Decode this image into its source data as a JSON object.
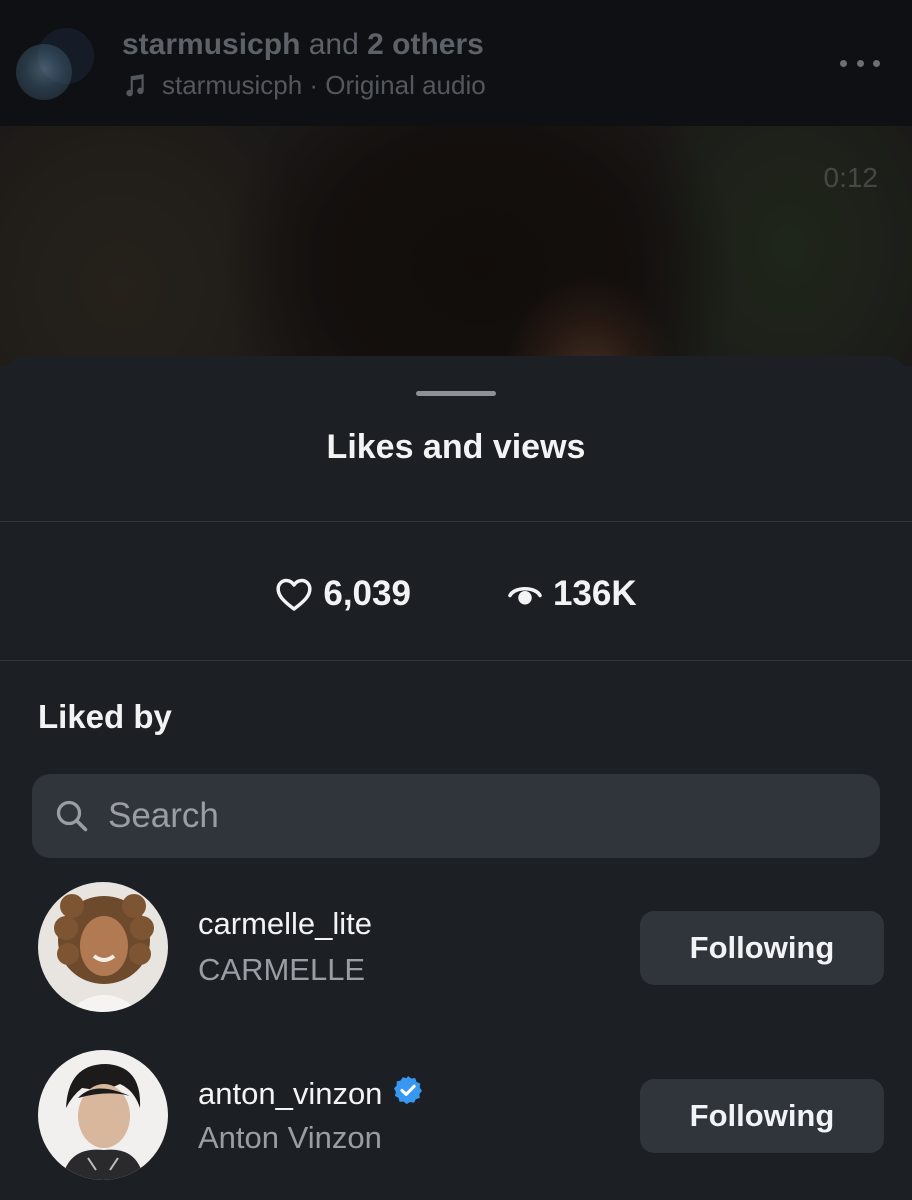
{
  "post": {
    "account": "starmusicph",
    "and_text": "and",
    "others": "2 others",
    "audio": "starmusicph · Original audio",
    "video_time": "0:12"
  },
  "sheet": {
    "title": "Likes and views",
    "likes": "6,039",
    "views": "136K",
    "liked_by_label": "Liked by",
    "search_placeholder": "Search"
  },
  "users": [
    {
      "username": "carmelle_lite",
      "full_name": "CARMELLE",
      "verified": false,
      "button": "Following"
    },
    {
      "username": "anton_vinzon",
      "full_name": "Anton Vinzon",
      "verified": true,
      "button": "Following"
    }
  ],
  "colors": {
    "background": "#1c1f24",
    "surface": "#30343b",
    "text_primary": "#f2f3f5",
    "text_secondary": "#9a9ea4",
    "verified_badge": "#3897f0"
  }
}
